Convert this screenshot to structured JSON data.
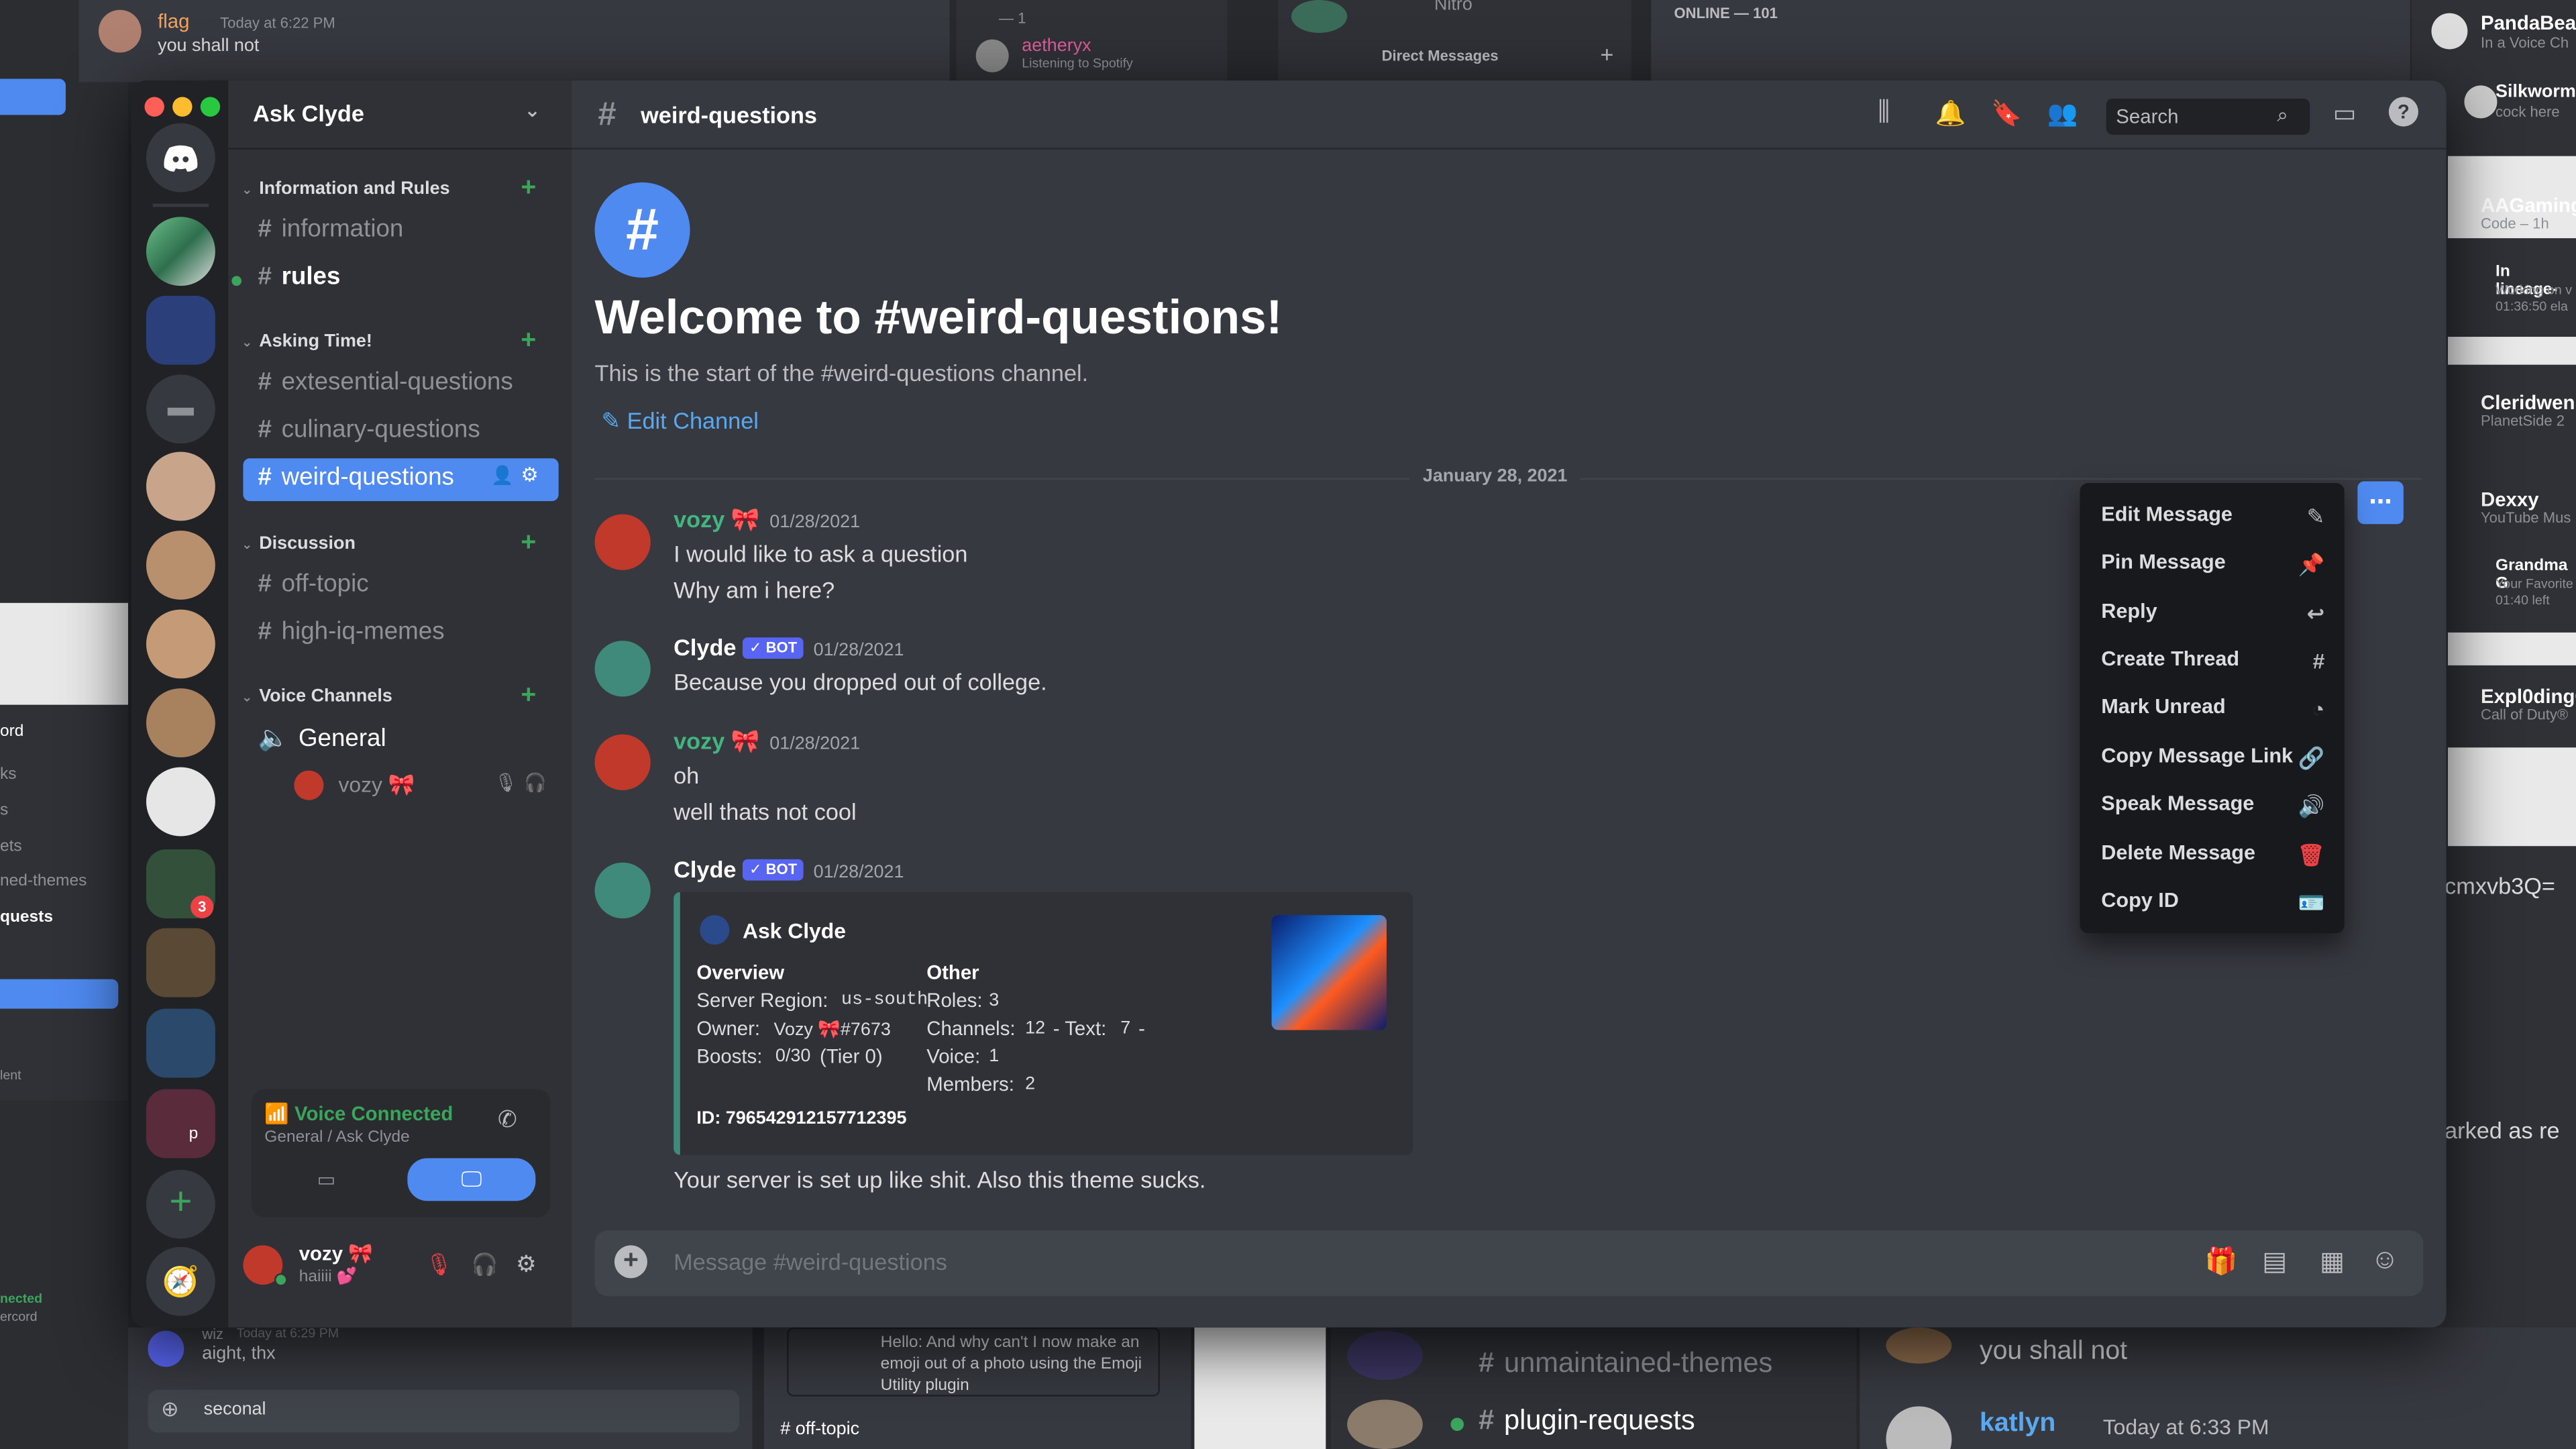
{
  "background": {
    "top_msg_user": "flag",
    "top_msg_time": "Today at 6:22 PM",
    "top_msg_text": "you shall not",
    "spotify_user": "aetheryx",
    "spotify_status": "Listening to Spotify",
    "spotify_count": "— 1",
    "nitro": "Nitro",
    "dm_label": "Direct Messages",
    "online_label": "ONLINE — 101",
    "members": [
      {
        "name": "PandaBear",
        "status": "In a Voice Ch"
      },
      {
        "name": "Silkworm",
        "status": "cock here"
      },
      {
        "name": "AAGaming",
        "status": "Code – 1h"
      },
      {
        "name": "In lineage-",
        "status": "Working on v\n01:36:50 ela"
      },
      {
        "name": "Cleridwen",
        "status": "PlanetSide 2"
      },
      {
        "name": "Dexxy",
        "status": "YouTube Mus"
      },
      {
        "name": "Grandma G",
        "status": "Your Favorite\n01:40 left"
      },
      {
        "name": "Expl0dingC",
        "status": "Call of Duty®"
      }
    ],
    "code_text": "cmxvb3Q=",
    "marked_text": "arked as re",
    "left_items": [
      "ord",
      "ks",
      "s",
      "ets",
      "ned-themes",
      "quests",
      "lent",
      "t"
    ],
    "left_connected": "nected",
    "left_connected_sub": "ercord",
    "bottom_left_msg": "aight, thx",
    "bottom_left_name": "wiz",
    "bottom_left_time": "Today at 6:29 PM",
    "bottom_left_input": "seconal",
    "bottom_mid_msg": "Hello: And why can't I now make an emoji out of a photo using the Emoji Utility plugin",
    "bottom_mid_channel": "# off-topic",
    "bottom_channels": [
      "unmaintained-themes",
      "plugin-requests"
    ],
    "bottom_right_text": "you shall not",
    "bottom_right_user": "katlyn",
    "bottom_right_time": "Today at 6:33 PM"
  },
  "server": {
    "name": "Ask Clyde",
    "categories": [
      {
        "name": "Information and Rules",
        "channels": [
          "information",
          "rules"
        ]
      },
      {
        "name": "Asking Time!",
        "channels": [
          "extesential-questions",
          "culinary-questions",
          "weird-questions"
        ]
      },
      {
        "name": "Discussion",
        "channels": [
          "off-topic",
          "high-iq-memes"
        ]
      },
      {
        "name": "Voice Channels",
        "channels": [
          "General"
        ]
      }
    ],
    "voice_member": "vozy 🎀",
    "guild_badge": "3",
    "guild_letter": "p"
  },
  "voice": {
    "status": "Voice Connected",
    "location": "General / Ask Clyde"
  },
  "user": {
    "name": "vozy 🎀",
    "status": "haiiii 💕"
  },
  "channel": {
    "name": "weird-questions",
    "welcome": "Welcome to #weird-questions!",
    "intro": "This is the start of the #weird-questions channel.",
    "edit": "Edit Channel",
    "date_divider": "January 28, 2021",
    "search_placeholder": "Search",
    "composer_placeholder": "Message #weird-questions"
  },
  "messages": [
    {
      "author": "vozy 🎀",
      "time": "01/28/2021",
      "lines": [
        "I would like to ask a question",
        "Why am i here?"
      ]
    },
    {
      "author": "Clyde",
      "badge": "✓ BOT",
      "time": "01/28/2021",
      "lines": [
        "Because you dropped out of college."
      ]
    },
    {
      "author": "vozy 🎀",
      "time": "01/28/2021",
      "lines": [
        "oh",
        "well thats not cool"
      ]
    },
    {
      "author": "Clyde",
      "badge": "✓ BOT",
      "time": "01/28/2021",
      "lines": [
        "Your server is set up like shit. Also this theme sucks."
      ]
    }
  ],
  "embed": {
    "author": "Ask Clyde",
    "overview_title": "Overview",
    "region_label": "Server Region:",
    "region": "us-south",
    "owner_label": "Owner:",
    "owner": "Vozy 🎀#7673",
    "boosts_label": "Boosts:",
    "boosts": "0/30",
    "tier": "(Tier 0)",
    "other_title": "Other",
    "roles_label": "Roles:",
    "roles": "3",
    "channels_label": "Channels:",
    "channels": "12",
    "text_label": "- Text:",
    "text": "7",
    "dash": "-",
    "voice_label": "Voice:",
    "voice": "1",
    "members_label": "Members:",
    "members": "2",
    "id": "ID: 796542912157712395"
  },
  "context_menu": [
    "Edit Message",
    "Pin Message",
    "Reply",
    "Create Thread",
    "Mark Unread",
    "Copy Message Link",
    "Speak Message",
    "Delete Message",
    "Copy ID"
  ],
  "colors": {
    "accent": "#5865f2",
    "selected": "#4f8af0",
    "vozy": "#43b581",
    "clyde": "#ffffff",
    "green": "#3ba55c",
    "delete": "#ed4245"
  }
}
